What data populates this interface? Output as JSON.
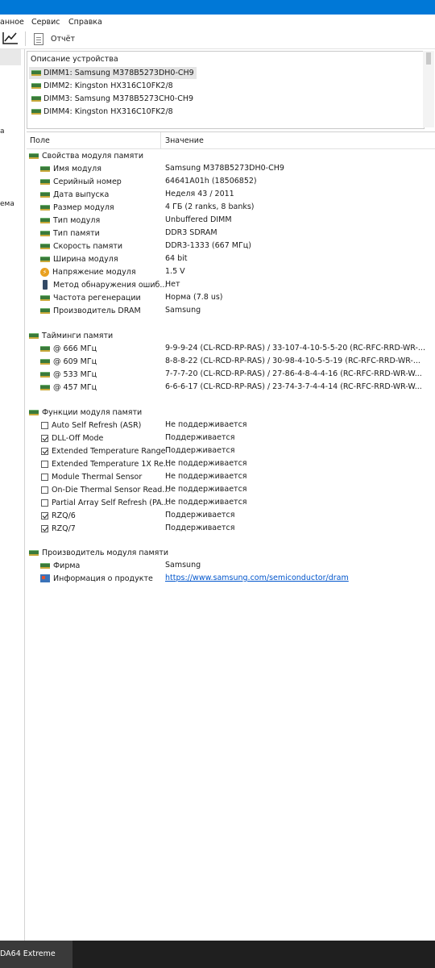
{
  "menu": {
    "items": [
      "анное",
      "Сервис",
      "Справка"
    ]
  },
  "toolbar": {
    "report_label": "Отчёт"
  },
  "left_tree": {
    "items": [
      "а",
      "ема"
    ]
  },
  "device_panel": {
    "header": "Описание устройства",
    "devices": [
      "DIMM1: Samsung M378B5273DH0-CH9",
      "DIMM2: Kingston HX316C10FK2/8",
      "DIMM3: Samsung M378B5273CH0-CH9",
      "DIMM4: Kingston HX316C10FK2/8"
    ]
  },
  "columns": {
    "field": "Поле",
    "value": "Значение"
  },
  "sections": {
    "props": {
      "title": "Свойства модуля памяти",
      "rows": [
        {
          "field": "Имя модуля",
          "value": "Samsung M378B5273DH0-CH9",
          "icon": "ram-icon"
        },
        {
          "field": "Серийный номер",
          "value": "64641A01h (18506852)",
          "icon": "ram-icon"
        },
        {
          "field": "Дата выпуска",
          "value": "Неделя 43 / 2011",
          "icon": "ram-icon"
        },
        {
          "field": "Размер модуля",
          "value": "4 ГБ (2 ranks, 8 banks)",
          "icon": "ram-icon"
        },
        {
          "field": "Тип модуля",
          "value": "Unbuffered DIMM",
          "icon": "ram-icon"
        },
        {
          "field": "Тип памяти",
          "value": "DDR3 SDRAM",
          "icon": "ram-icon"
        },
        {
          "field": "Скорость памяти",
          "value": "DDR3-1333 (667 МГц)",
          "icon": "ram-icon"
        },
        {
          "field": "Ширина модуля",
          "value": "64 bit",
          "icon": "ram-icon"
        },
        {
          "field": "Напряжение модуля",
          "value": "1.5 V",
          "icon": "voltage-icon"
        },
        {
          "field": "Метод обнаружения ошиб...",
          "value": "Нет",
          "icon": "device-icon"
        },
        {
          "field": "Частота регенерации",
          "value": "Норма (7.8 us)",
          "icon": "ram-icon"
        },
        {
          "field": "Производитель DRAM",
          "value": "Samsung",
          "icon": "ram-icon"
        }
      ]
    },
    "timings": {
      "title": "Тайминги памяти",
      "rows": [
        {
          "field": "@ 666 МГц",
          "value": "9-9-9-24  (CL-RCD-RP-RAS) / 33-107-4-10-5-5-20  (RC-RFC-RRD-WR-..."
        },
        {
          "field": "@ 609 МГц",
          "value": "8-8-8-22  (CL-RCD-RP-RAS) / 30-98-4-10-5-5-19  (RC-RFC-RRD-WR-..."
        },
        {
          "field": "@ 533 МГц",
          "value": "7-7-7-20  (CL-RCD-RP-RAS) / 27-86-4-8-4-4-16  (RC-RFC-RRD-WR-W..."
        },
        {
          "field": "@ 457 МГц",
          "value": "6-6-6-17  (CL-RCD-RP-RAS) / 23-74-3-7-4-4-14  (RC-RFC-RRD-WR-W..."
        }
      ]
    },
    "functions": {
      "title": "Функции модуля памяти",
      "rows": [
        {
          "field": "Auto Self Refresh (ASR)",
          "value": "Не поддерживается",
          "checked": false
        },
        {
          "field": "DLL-Off Mode",
          "value": "Поддерживается",
          "checked": true
        },
        {
          "field": "Extended Temperature Range",
          "value": "Поддерживается",
          "checked": true
        },
        {
          "field": "Extended Temperature 1X Re...",
          "value": "Не поддерживается",
          "checked": false
        },
        {
          "field": "Module Thermal Sensor",
          "value": "Не поддерживается",
          "checked": false
        },
        {
          "field": "On-Die Thermal Sensor Read...",
          "value": "Не поддерживается",
          "checked": false
        },
        {
          "field": "Partial Array Self Refresh (PA...",
          "value": "Не поддерживается",
          "checked": false
        },
        {
          "field": "RZQ/6",
          "value": "Поддерживается",
          "checked": true
        },
        {
          "field": "RZQ/7",
          "value": "Поддерживается",
          "checked": true
        }
      ]
    },
    "manufacturer": {
      "title": "Производитель модуля памяти",
      "rows": [
        {
          "field": "Фирма",
          "value": "Samsung",
          "icon": "ram-icon"
        },
        {
          "field": "Информация о продукте",
          "value": "https://www.samsung.com/semiconductor/dram",
          "icon": "info-icon"
        }
      ]
    }
  },
  "taskbar": {
    "app_label": "DA64 Extreme"
  },
  "colors": {
    "titlebar": "#0078d7",
    "link": "#0055cc",
    "taskbar": "#1f1f1f"
  }
}
